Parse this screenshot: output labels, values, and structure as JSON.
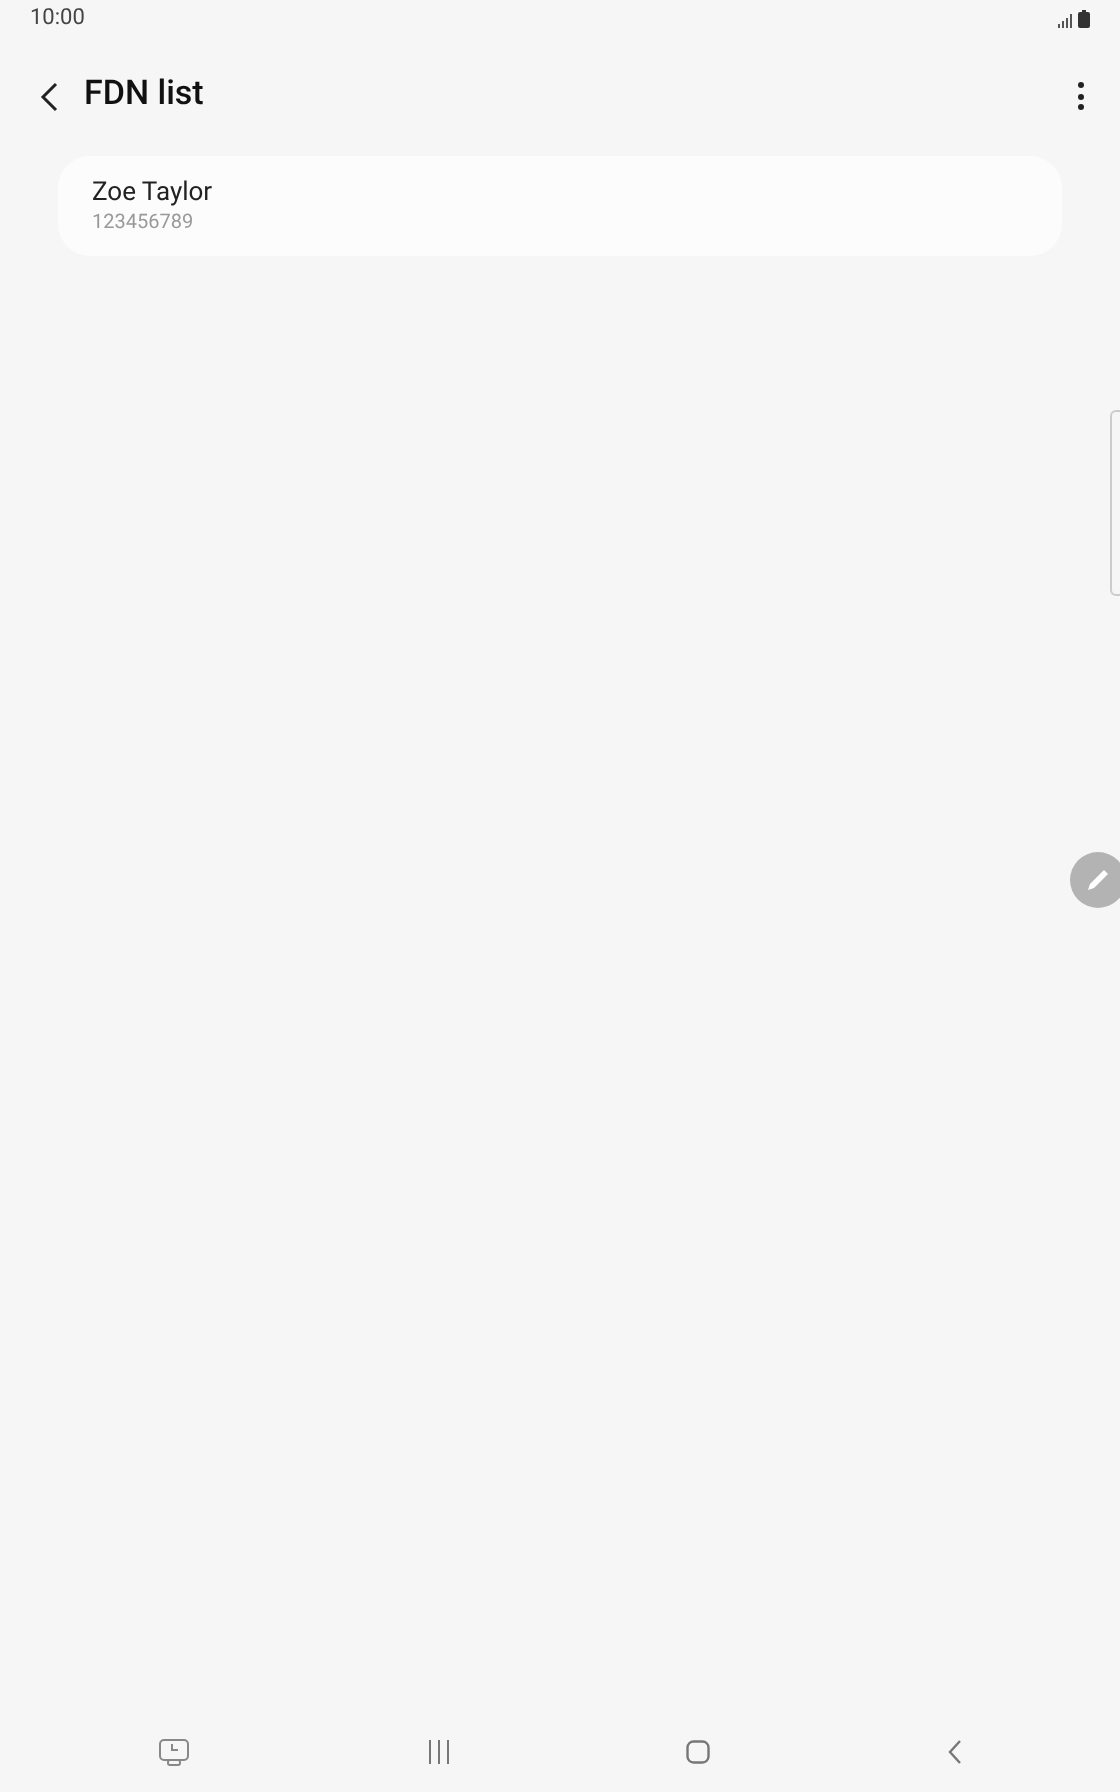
{
  "status_bar": {
    "time": "10:00"
  },
  "header": {
    "title": "FDN list"
  },
  "contacts": [
    {
      "name": "Zoe Taylor",
      "number": "123456789"
    }
  ]
}
